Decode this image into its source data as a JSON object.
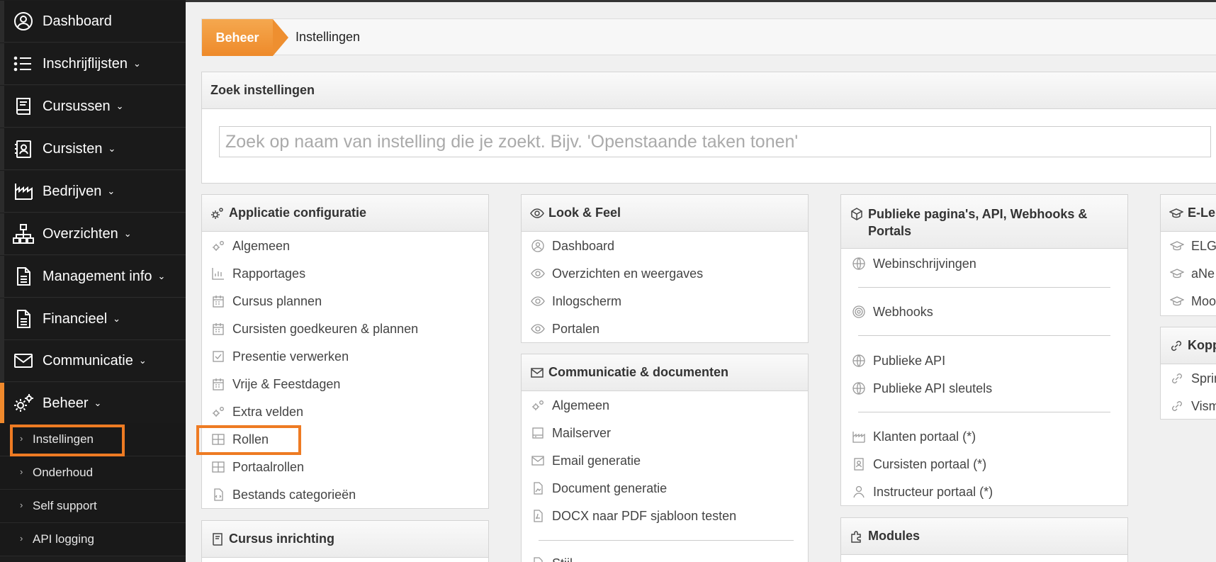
{
  "sidebar": {
    "items": [
      {
        "label": "Dashboard",
        "icon": "user-circle-icon",
        "chevron": ""
      },
      {
        "label": "Inschrijflijsten",
        "icon": "list-icon",
        "chevron": "⌄"
      },
      {
        "label": "Cursussen",
        "icon": "book-icon",
        "chevron": "⌄"
      },
      {
        "label": "Cursisten",
        "icon": "contact-card-icon",
        "chevron": "⌄"
      },
      {
        "label": "Bedrijven",
        "icon": "industry-icon",
        "chevron": "⌄"
      },
      {
        "label": "Overzichten",
        "icon": "sitemap-icon",
        "chevron": "⌄"
      },
      {
        "label": "Management info",
        "icon": "document-icon",
        "chevron": "⌄"
      },
      {
        "label": "Financieel",
        "icon": "document-icon",
        "chevron": "⌄"
      },
      {
        "label": "Communicatie",
        "icon": "envelope-icon",
        "chevron": "⌄"
      },
      {
        "label": "Beheer",
        "icon": "gears-icon",
        "chevron": "⌄"
      }
    ],
    "subitems": [
      {
        "label": "Instellingen"
      },
      {
        "label": "Onderhoud"
      },
      {
        "label": "Self support"
      },
      {
        "label": "API logging"
      }
    ],
    "arrow": "›"
  },
  "breadcrumb": {
    "home": "Beheer",
    "current": "Instellingen"
  },
  "search": {
    "title": "Zoek instellingen",
    "placeholder": "Zoek op naam van instelling die je zoekt. Bijv. 'Openstaande taken tonen'"
  },
  "panels": {
    "app": {
      "title": "Applicatie configuratie",
      "items": [
        "Algemeen",
        "Rapportages",
        "Cursus plannen",
        "Cursisten goedkeuren & plannen",
        "Presentie verwerken",
        "Vrije & Feestdagen",
        "Extra velden",
        "Rollen",
        "Portaalrollen",
        "Bestands categorieën"
      ]
    },
    "cursus": {
      "title": "Cursus inrichting"
    },
    "look": {
      "title": "Look & Feel",
      "items": [
        "Dashboard",
        "Overzichten en weergaves",
        "Inlogscherm",
        "Portalen"
      ]
    },
    "comm": {
      "title": "Communicatie & documenten",
      "items": [
        "Algemeen",
        "Mailserver",
        "Email generatie",
        "Document generatie",
        "DOCX naar PDF sjabloon testen",
        "Stijl"
      ]
    },
    "public": {
      "title": "Publieke pagina's, API, Webhooks & Portals",
      "items": [
        "Webinschrijvingen",
        "Webhooks",
        "Publieke API",
        "Publieke API sleutels",
        "Klanten portaal (*)",
        "Cursisten portaal (*)",
        "Instructeur portaal (*)"
      ]
    },
    "modules": {
      "title": "Modules"
    },
    "elearn": {
      "title": "E-Le",
      "items": [
        "ELGI",
        "aNe",
        "Moo"
      ]
    },
    "kopp": {
      "title": "Kopp",
      "items": [
        "Sprin",
        "Vism"
      ]
    }
  },
  "colors": {
    "accent": "#ee7b23",
    "sidebar": "#1d1d1d"
  }
}
